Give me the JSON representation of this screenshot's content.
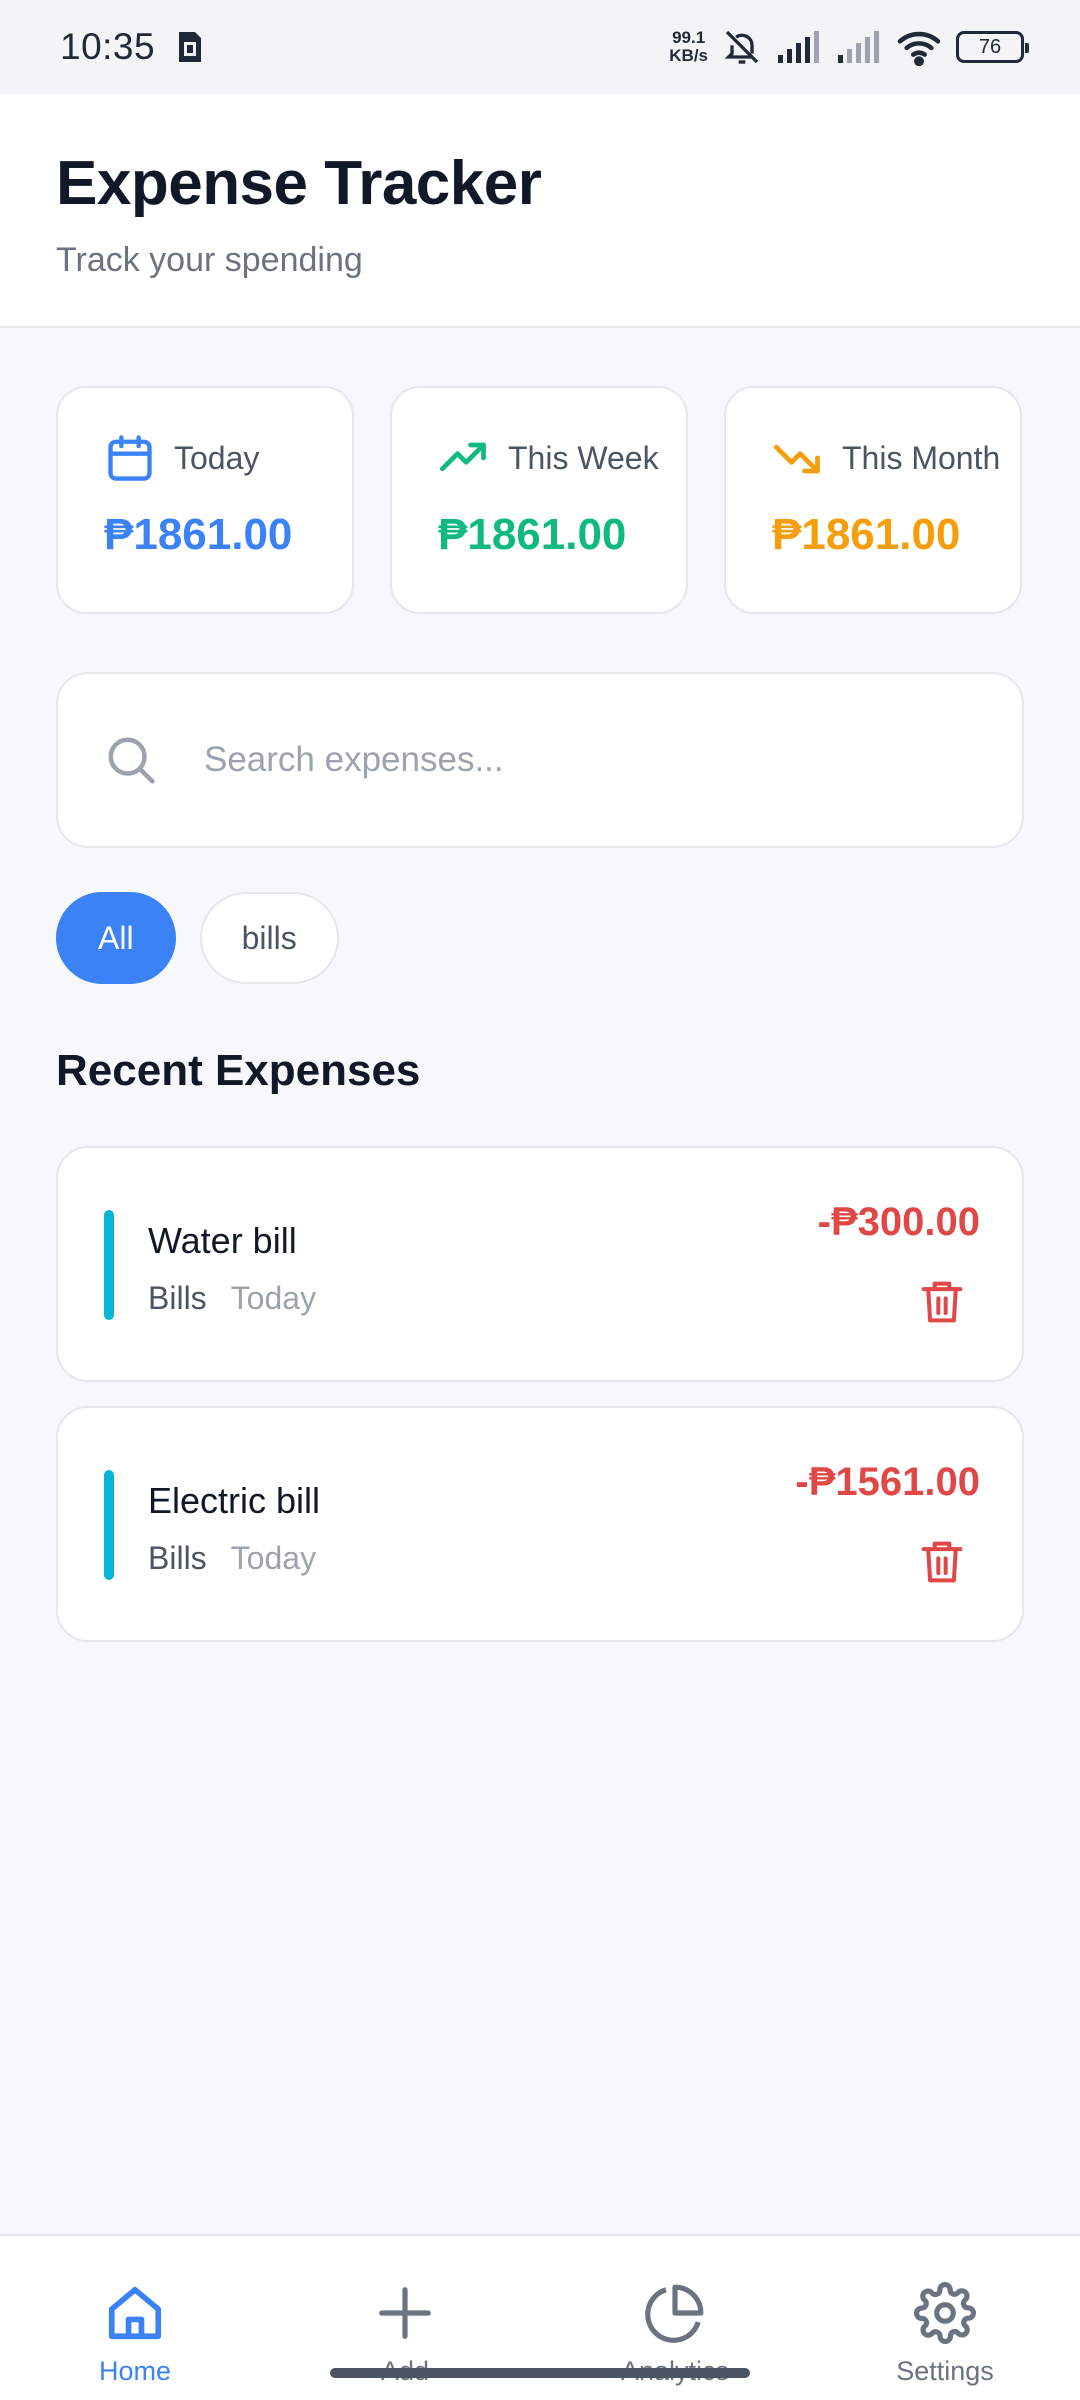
{
  "status_bar": {
    "time": "10:35",
    "net_speed_value": "99.1",
    "net_speed_unit": "KB/s",
    "battery": "76"
  },
  "header": {
    "title": "Expense Tracker",
    "subtitle": "Track your spending"
  },
  "summary": [
    {
      "label": "Today",
      "value": "₱1861.00",
      "icon": "calendar-icon",
      "color": "#3b82f6"
    },
    {
      "label": "This Week",
      "value": "₱1861.00",
      "icon": "trending-up-icon",
      "color": "#10b981"
    },
    {
      "label": "This Month",
      "value": "₱1861.00",
      "icon": "trending-down-icon",
      "color": "#f59e0b"
    }
  ],
  "search": {
    "placeholder": "Search expenses...",
    "value": ""
  },
  "filters": [
    {
      "label": "All",
      "active": true
    },
    {
      "label": "bills",
      "active": false
    }
  ],
  "section_title": "Recent Expenses",
  "expenses": [
    {
      "title": "Water bill",
      "category": "Bills",
      "date": "Today",
      "amount": "-₱300.00",
      "accent_color": "#06b6d4"
    },
    {
      "title": "Electric bill",
      "category": "Bills",
      "date": "Today",
      "amount": "-₱1561.00",
      "accent_color": "#06b6d4"
    }
  ],
  "nav": [
    {
      "label": "Home",
      "icon": "home-icon",
      "active": true
    },
    {
      "label": "Add",
      "icon": "plus-icon",
      "active": false
    },
    {
      "label": "Analytics",
      "icon": "pie-chart-icon",
      "active": false
    },
    {
      "label": "Settings",
      "icon": "gear-icon",
      "active": false
    }
  ],
  "colors": {
    "primary": "#3b82f6",
    "danger": "#e04848",
    "success": "#10b981",
    "warning": "#f59e0b"
  }
}
